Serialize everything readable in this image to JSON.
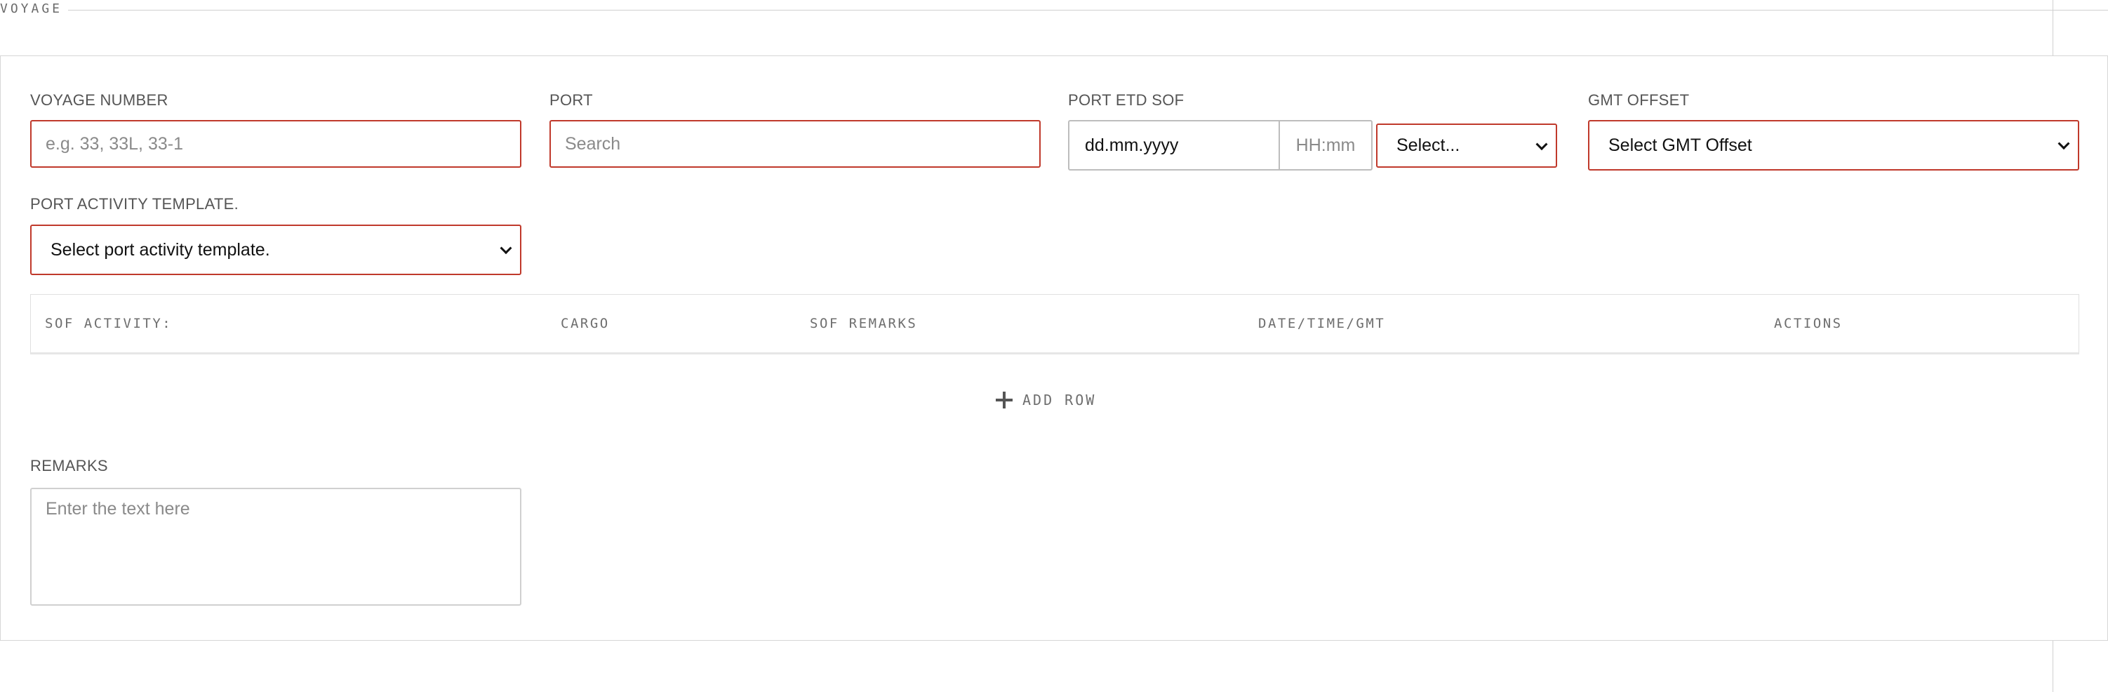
{
  "section": {
    "title": "VOYAGE"
  },
  "form": {
    "voyage_number": {
      "label": "VOYAGE NUMBER",
      "placeholder": "e.g. 33, 33L, 33-1"
    },
    "port": {
      "label": "PORT",
      "placeholder": "Search"
    },
    "port_etd_sof": {
      "label": "PORT ETD SOF",
      "date_placeholder": "dd.mm.yyyy",
      "time_placeholder": "HH:mm",
      "select_value": "Select..."
    },
    "gmt_offset": {
      "label": "GMT OFFSET",
      "select_value": "Select GMT Offset"
    },
    "port_activity_template": {
      "label": "PORT ACTIVITY TEMPLATE.",
      "select_value": "Select port activity template."
    },
    "remarks": {
      "label": "REMARKS",
      "placeholder": "Enter the text here"
    }
  },
  "table": {
    "columns": [
      "SOF ACTIVITY:",
      "CARGO",
      "SOF REMARKS",
      "DATE/TIME/GMT",
      "ACTIONS"
    ]
  },
  "add_row": {
    "label": "ADD ROW",
    "icon": "plus-icon"
  },
  "colors": {
    "required_border": "#c0392b",
    "neutral_border": "#d0d0d0",
    "label_text": "#555555"
  }
}
